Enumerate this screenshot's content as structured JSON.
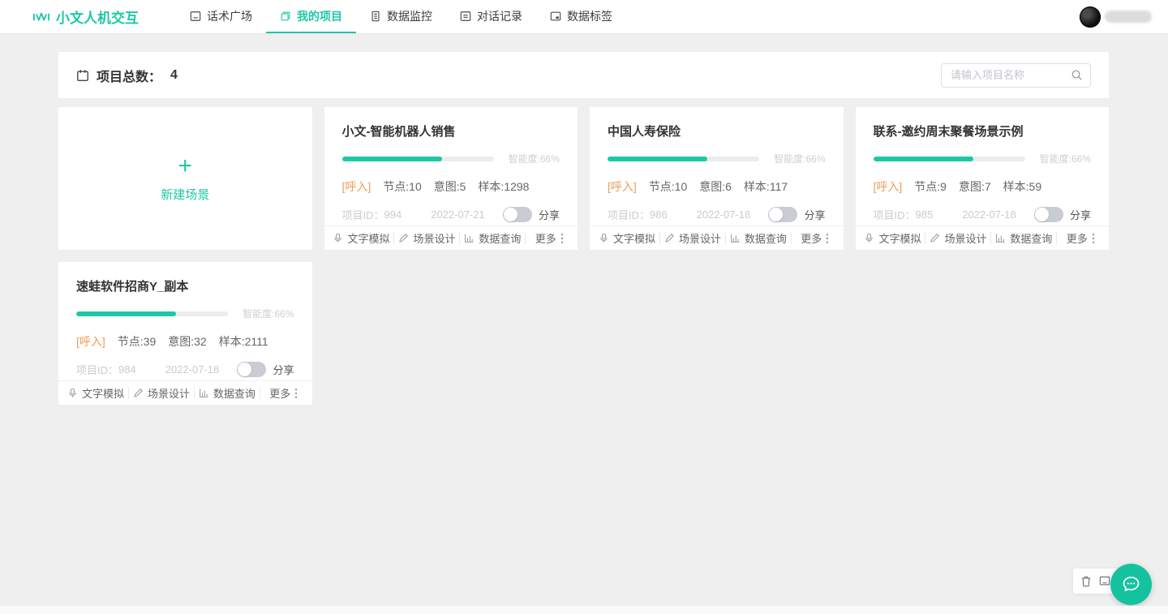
{
  "accent_color": "#1dc8a6",
  "orange_color": "#f09c57",
  "nav": {
    "logo_text": "小文人机交互",
    "tabs": [
      {
        "label": "话术广场"
      },
      {
        "label": "我的项目"
      },
      {
        "label": "数据监控"
      },
      {
        "label": "对话记录"
      },
      {
        "label": "数据标签"
      }
    ],
    "active_tab": "我的项目"
  },
  "header": {
    "total_label": "项目总数：",
    "total_count": "4",
    "search_placeholder": "请输入项目名称"
  },
  "new_scene": {
    "plus": "+",
    "label": "新建场景"
  },
  "cards": [
    {
      "title": "小文-智能机器人销售",
      "intelligence": "智能度:66%",
      "progress": 66,
      "call_tag": "[呼入]",
      "nodes": "节点:10",
      "intents": "意图:5",
      "samples": "样本:1298",
      "project_id_label": "项目ID：",
      "project_id": "994",
      "date": "2022-07-21",
      "share_label": "分享",
      "share_on": false
    },
    {
      "title": "中国人寿保险",
      "intelligence": "智能度:66%",
      "progress": 66,
      "call_tag": "[呼入]",
      "nodes": "节点:10",
      "intents": "意图:6",
      "samples": "样本:117",
      "project_id_label": "项目ID：",
      "project_id": "986",
      "date": "2022-07-18",
      "share_label": "分享",
      "share_on": false
    },
    {
      "title": "联系-邀约周末聚餐场景示例",
      "intelligence": "智能度:66%",
      "progress": 66,
      "call_tag": "[呼入]",
      "nodes": "节点:9",
      "intents": "意图:7",
      "samples": "样本:59",
      "project_id_label": "项目ID：",
      "project_id": "985",
      "date": "2022-07-18",
      "share_label": "分享",
      "share_on": false
    },
    {
      "title": "速蛙软件招商Y_副本",
      "intelligence": "智能度:66%",
      "progress": 66,
      "call_tag": "[呼入]",
      "nodes": "节点:39",
      "intents": "意图:32",
      "samples": "样本:2111",
      "project_id_label": "项目ID：",
      "project_id": "984",
      "date": "2022-07-18",
      "share_label": "分享",
      "share_on": false
    }
  ],
  "card_actions": [
    {
      "label": "文字模拟",
      "icon": "mic-icon"
    },
    {
      "label": "场景设计",
      "icon": "pencil-icon"
    },
    {
      "label": "数据查询",
      "icon": "chart-icon"
    },
    {
      "label": "更多",
      "icon": "more-dots-icon"
    }
  ]
}
